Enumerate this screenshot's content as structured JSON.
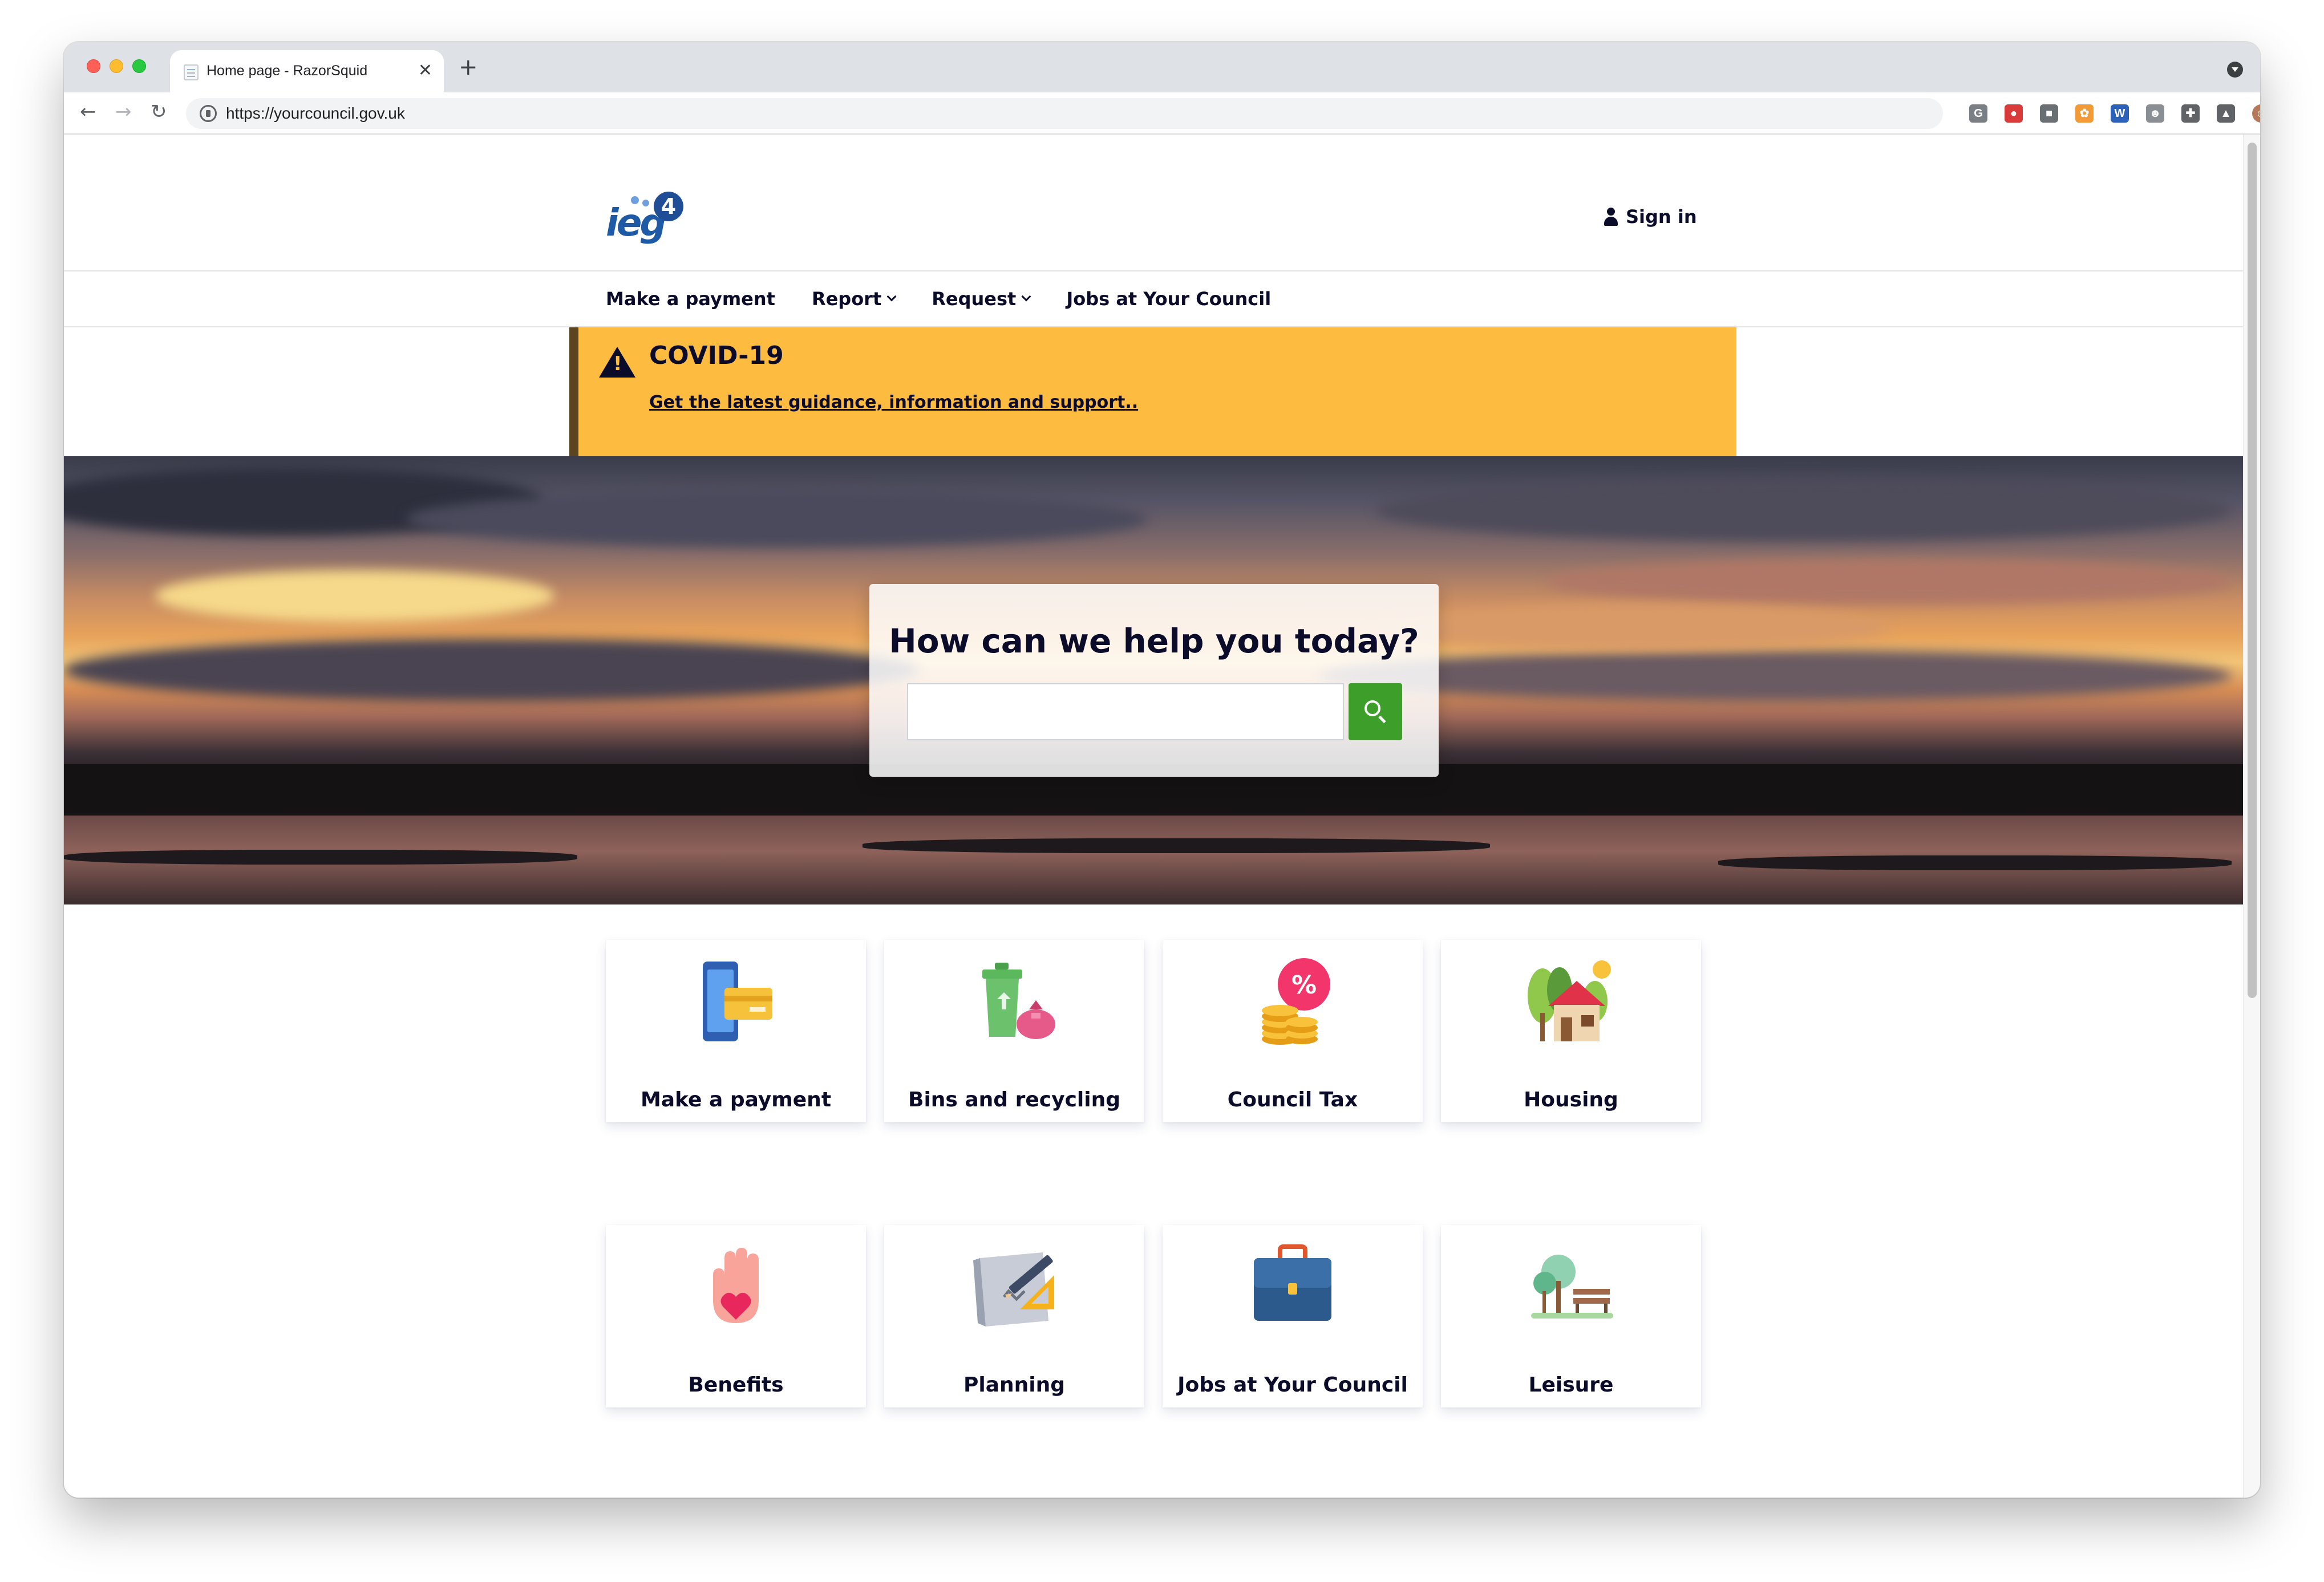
{
  "browser": {
    "tab_title": "Home page - RazorSquid",
    "tab_close": "✕",
    "new_tab": "+",
    "back": "←",
    "forward": "→",
    "reload": "↻",
    "url": "https://yourcouncil.gov.uk",
    "extensions": [
      {
        "name": "g-extension-icon",
        "glyph": "G",
        "color": "#7a7f86"
      },
      {
        "name": "location-pin-icon",
        "glyph": "●",
        "color": "#d93a3a"
      },
      {
        "name": "square-extension-icon",
        "glyph": "■",
        "color": "#6a6f76"
      },
      {
        "name": "orange-extension-icon",
        "glyph": "✿",
        "color": "#f29a35"
      },
      {
        "name": "word-extension-icon",
        "glyph": "W",
        "color": "#2b61b8"
      },
      {
        "name": "person-extension-icon",
        "glyph": "☻",
        "color": "#8a8f96"
      },
      {
        "name": "puzzle-icon",
        "glyph": "✚",
        "color": "#5f6368"
      },
      {
        "name": "flask-icon",
        "glyph": "▲",
        "color": "#5f6368"
      },
      {
        "name": "profile-avatar-icon",
        "glyph": "☺",
        "color": "#b67a5a"
      },
      {
        "name": "kebab-menu-icon",
        "glyph": "⋮",
        "color": "#5f6368"
      }
    ]
  },
  "header": {
    "logo_text": "ieg",
    "logo_badge": "4",
    "signin_label": "Sign in"
  },
  "nav": {
    "items": [
      {
        "label": "Make a payment",
        "dropdown": false
      },
      {
        "label": "Report",
        "dropdown": true
      },
      {
        "label": "Request",
        "dropdown": true
      },
      {
        "label": "Jobs at Your Council",
        "dropdown": false
      }
    ]
  },
  "alert": {
    "title": "COVID-19",
    "link": "Get the latest guidance, information and support",
    "link_suffix": ".."
  },
  "hero": {
    "title": "How can we help you today?",
    "search_placeholder": ""
  },
  "tiles": [
    {
      "label": "Make a payment",
      "icon": "payment-phone-card-icon"
    },
    {
      "label": "Bins and recycling",
      "icon": "recycling-bin-icon"
    },
    {
      "label": "Council Tax",
      "icon": "coins-percent-icon"
    },
    {
      "label": "Housing",
      "icon": "house-trees-icon"
    },
    {
      "label": "Benefits",
      "icon": "hand-heart-icon"
    },
    {
      "label": "Planning",
      "icon": "blueprint-pencil-icon"
    },
    {
      "label": "Jobs at Your Council",
      "icon": "briefcase-icon"
    },
    {
      "label": "Leisure",
      "icon": "park-bench-icon"
    }
  ],
  "colors": {
    "alert_bg": "#fdbb3f",
    "search_button": "#3d9e2a",
    "text_dark": "#0b0c2a"
  }
}
